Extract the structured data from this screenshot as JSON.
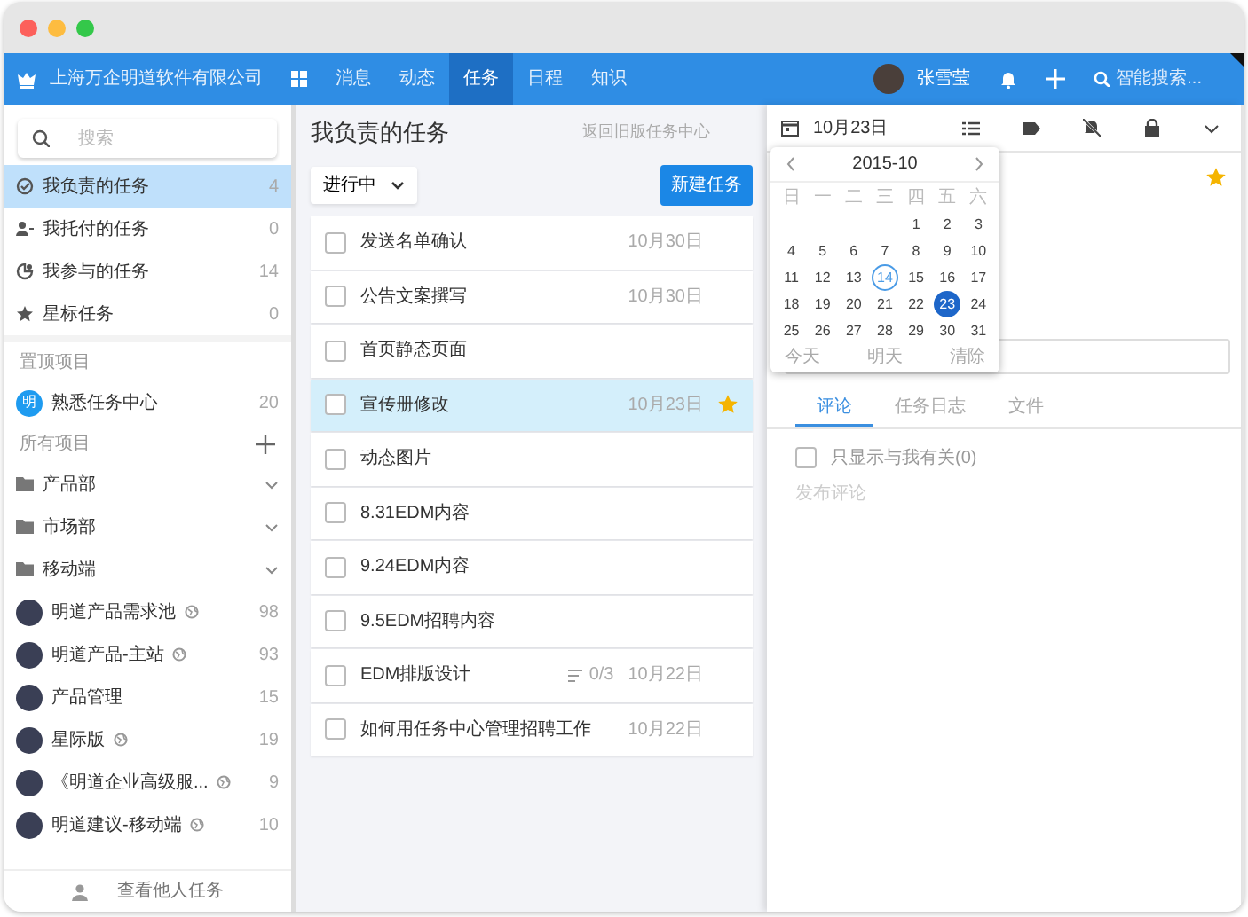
{
  "header": {
    "company": "上海万企明道软件有限公司",
    "nav": [
      {
        "label": "消息",
        "selected": false
      },
      {
        "label": "动态",
        "selected": false
      },
      {
        "label": "任务",
        "selected": true
      },
      {
        "label": "日程",
        "selected": false
      },
      {
        "label": "知识",
        "selected": false
      }
    ],
    "user": "张雪莹",
    "search_placeholder": "智能搜索..."
  },
  "sidebar": {
    "search_placeholder": "搜索",
    "items": [
      {
        "kind": "mine",
        "label": "我负责的任务",
        "count": "4",
        "selected": true
      },
      {
        "kind": "assigned",
        "label": "我托付的任务",
        "count": "0",
        "selected": false
      },
      {
        "kind": "joined",
        "label": "我参与的任务",
        "count": "14",
        "selected": false
      },
      {
        "kind": "starred",
        "label": "星标任务",
        "count": "0",
        "selected": false
      }
    ],
    "pinned_heading": "置顶项目",
    "pinned": [
      {
        "badge": "明",
        "label": "熟悉任务中心",
        "count": "20"
      }
    ],
    "all_heading": "所有项目",
    "folders": [
      {
        "label": "产品部"
      },
      {
        "label": "市场部"
      },
      {
        "label": "移动端"
      }
    ],
    "projects": [
      {
        "label": "明道产品需求池",
        "public": true,
        "count": "98"
      },
      {
        "label": "明道产品-主站",
        "public": true,
        "count": "93"
      },
      {
        "label": "产品管理",
        "public": false,
        "count": "15"
      },
      {
        "label": "星际版",
        "public": true,
        "count": "19"
      },
      {
        "label": "《明道企业高级服...",
        "public": true,
        "count": "9"
      },
      {
        "label": "明道建议-移动端",
        "public": true,
        "count": "10"
      }
    ],
    "footer": "查看他人任务"
  },
  "tasks_panel": {
    "title": "我负责的任务",
    "old_link": "返回旧版任务中心",
    "filter": "进行中",
    "new_button": "新建任务",
    "tasks": [
      {
        "title": "发送名单确认",
        "date": "10月30日",
        "starred": false,
        "selected": false
      },
      {
        "title": "公告文案撰写",
        "date": "10月30日",
        "starred": false,
        "selected": false
      },
      {
        "title": "首页静态页面",
        "starred": false,
        "selected": false
      },
      {
        "title": "宣传册修改",
        "date": "10月23日",
        "starred": true,
        "selected": true
      },
      {
        "title": "动态图片",
        "starred": false,
        "selected": false
      },
      {
        "title": "8.31EDM内容",
        "starred": false,
        "selected": false
      },
      {
        "title": "9.24EDM内容",
        "starred": false,
        "selected": false
      },
      {
        "title": "9.5EDM招聘内容",
        "starred": false,
        "selected": false
      },
      {
        "title": "EDM排版设计",
        "subtasks": "0/3",
        "date": "10月22日",
        "starred": false,
        "selected": false
      },
      {
        "title": "如何用任务中心管理招聘工作",
        "date": "10月22日",
        "starred": false,
        "selected": false
      }
    ]
  },
  "detail": {
    "date": "10月23日",
    "starred": true,
    "tabs": [
      {
        "label": "评论",
        "selected": true
      },
      {
        "label": "任务日志",
        "selected": false
      },
      {
        "label": "文件",
        "selected": false
      }
    ],
    "filter": {
      "label": "只显示与我有关(0)",
      "checked": false
    },
    "comment_placeholder": "发布评论"
  },
  "calendar": {
    "title": "2015-10",
    "weekdays": [
      "日",
      "一",
      "二",
      "三",
      "四",
      "五",
      "六"
    ],
    "weeks": [
      [
        {
          "day": "1",
          "today": false,
          "selected": false
        },
        {
          "day": "2",
          "today": false,
          "selected": false
        },
        {
          "day": "3",
          "today": false,
          "selected": false
        }
      ],
      [
        {
          "day": "4",
          "today": false,
          "selected": false
        },
        {
          "day": "5",
          "today": false,
          "selected": false
        },
        {
          "day": "6",
          "today": false,
          "selected": false
        },
        {
          "day": "7",
          "today": false,
          "selected": false
        },
        {
          "day": "8",
          "today": false,
          "selected": false
        },
        {
          "day": "9",
          "today": false,
          "selected": false
        },
        {
          "day": "10",
          "today": false,
          "selected": false
        }
      ],
      [
        {
          "day": "11",
          "today": false,
          "selected": false
        },
        {
          "day": "12",
          "today": false,
          "selected": false
        },
        {
          "day": "13",
          "today": false,
          "selected": false
        },
        {
          "day": "14",
          "today": true,
          "selected": false
        },
        {
          "day": "15",
          "today": false,
          "selected": false
        },
        {
          "day": "16",
          "today": false,
          "selected": false
        },
        {
          "day": "17",
          "today": false,
          "selected": false
        }
      ],
      [
        {
          "day": "18",
          "today": false,
          "selected": false
        },
        {
          "day": "19",
          "today": false,
          "selected": false
        },
        {
          "day": "20",
          "today": false,
          "selected": false
        },
        {
          "day": "21",
          "today": false,
          "selected": false
        },
        {
          "day": "22",
          "today": false,
          "selected": false
        },
        {
          "day": "23",
          "today": false,
          "selected": true
        },
        {
          "day": "24",
          "today": false,
          "selected": false
        }
      ],
      [
        {
          "day": "25",
          "today": false,
          "selected": false
        },
        {
          "day": "26",
          "today": false,
          "selected": false
        },
        {
          "day": "27",
          "today": false,
          "selected": false
        },
        {
          "day": "28",
          "today": false,
          "selected": false
        },
        {
          "day": "29",
          "today": false,
          "selected": false
        },
        {
          "day": "30",
          "today": false,
          "selected": false
        },
        {
          "day": "31",
          "today": false,
          "selected": false
        }
      ]
    ],
    "footer": [
      "今天",
      "明天",
      "清除"
    ]
  }
}
